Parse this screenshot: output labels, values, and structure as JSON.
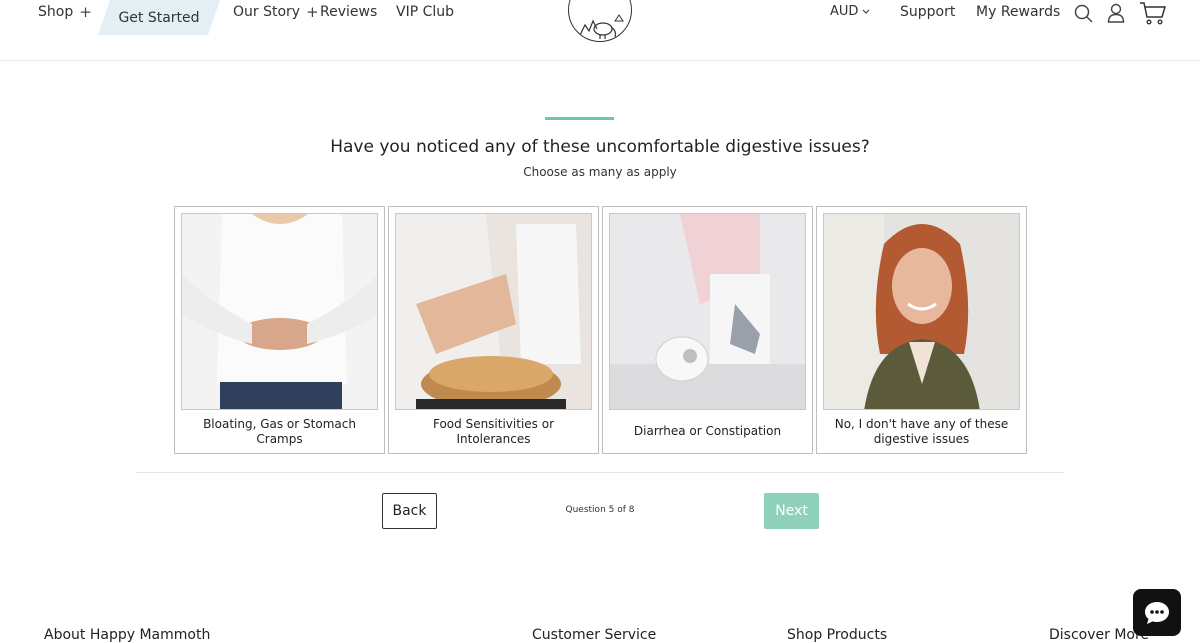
{
  "header": {
    "nav": {
      "shop": "Shop",
      "get_started": "Get Started",
      "our_story": "Our Story",
      "reviews": "Reviews",
      "vip_club": "VIP Club"
    },
    "currency": "AUD",
    "support": "Support",
    "my_rewards": "My Rewards",
    "icons": [
      "search-icon",
      "account-icon",
      "cart-icon"
    ]
  },
  "quiz": {
    "title": "Have you noticed any of these uncomfortable digestive issues?",
    "subtitle": "Choose as many as apply",
    "options": [
      {
        "label": "Bloating, Gas or Stomach Cramps"
      },
      {
        "label": "Food Sensitivities or Intolerances"
      },
      {
        "label": "Diarrhea or Constipation"
      },
      {
        "label": "No, I don't have any of these digestive issues"
      }
    ],
    "back_label": "Back",
    "progress": "Question 5 of 8",
    "next_label": "Next"
  },
  "footer": {
    "columns": [
      "About Happy Mammoth",
      "Customer Service",
      "Shop Products",
      "Discover More"
    ]
  },
  "colors": {
    "accent": "#6fc4ad",
    "next_button": "#8fd1bd",
    "nav_highlight": "#e4eff5"
  }
}
